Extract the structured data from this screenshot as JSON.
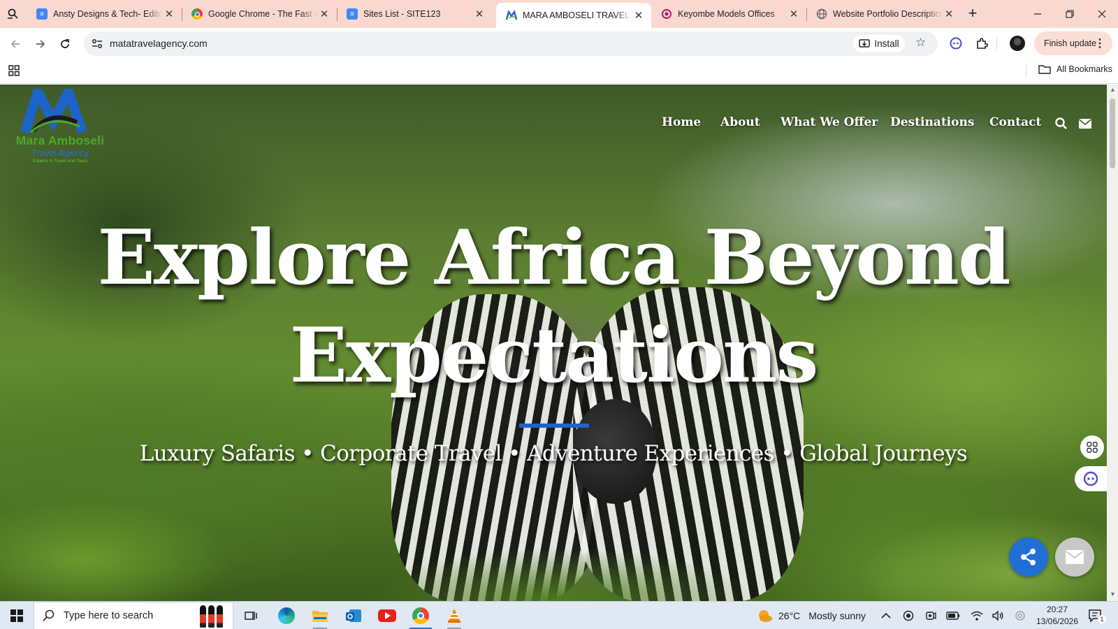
{
  "browser": {
    "tabs": [
      {
        "title": "Ansty Designs & Tech- Editor",
        "icon": "docs-icon",
        "color": "#4285f4"
      },
      {
        "title": "Google Chrome - The Fast & Secure Web Browser",
        "icon": "chrome-icon",
        "color": "#34a853"
      },
      {
        "title": "Sites List - SITE123",
        "icon": "docs-icon",
        "color": "#4285f4"
      },
      {
        "title": "MARA AMBOSELI TRAVEL AGENCY",
        "icon": "site-logo-icon",
        "color": "#1e63c9",
        "active": true
      },
      {
        "title": "Keyombe Models Offices",
        "icon": "site-icon",
        "color": "#c2185b"
      },
      {
        "title": "Website Portfolio Description",
        "icon": "globe-icon",
        "color": "#5f6368"
      }
    ],
    "url": "matatravelagency.com",
    "install_label": "Install",
    "finish_update_label": "Finish update",
    "all_bookmarks_label": "All Bookmarks"
  },
  "site": {
    "logo": {
      "name": "Mara Amboseli",
      "subtitle": "Travel Agency",
      "tagline": "Experts in Travel and Tours"
    },
    "nav": [
      "Home",
      "About",
      "What We Offer",
      "Destinations",
      "Contact"
    ],
    "hero": {
      "title_line1": "Explore Africa Beyond",
      "title_line2": "Expectations",
      "subtitle": "Luxury Safaris • Corporate Travel • Adventure Experiences • Global Journeys",
      "accent_color": "#1e63c9"
    }
  },
  "taskbar": {
    "search_placeholder": "Type here to search",
    "weather_temp": "26°C",
    "weather_text": "Mostly sunny",
    "time": "20:27",
    "date": "13/06/2026",
    "notification_count": "1"
  }
}
